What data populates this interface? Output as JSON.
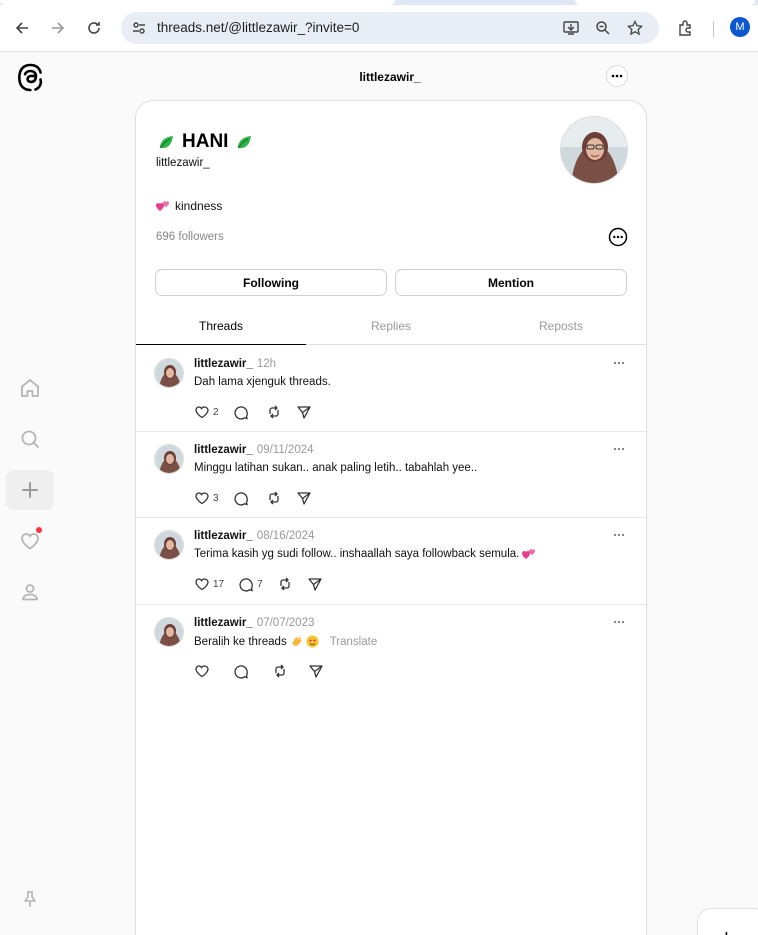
{
  "browser": {
    "url": "threads.net/@littlezawir_?invite=0",
    "profile_initial": "M"
  },
  "header": {
    "title": "littlezawir_"
  },
  "profile": {
    "display_name": "HANI",
    "username": "littlezawir_",
    "bio": "kindness",
    "followers": "696 followers",
    "following_label": "Following",
    "mention_label": "Mention"
  },
  "tabs": [
    {
      "label": "Threads",
      "active": true
    },
    {
      "label": "Replies",
      "active": false
    },
    {
      "label": "Reposts",
      "active": false
    }
  ],
  "posts": [
    {
      "username": "littlezawir_",
      "time": "12h",
      "text": "Dah lama xjenguk threads.",
      "likes": "2",
      "replies": "",
      "translate": ""
    },
    {
      "username": "littlezawir_",
      "time": "09/11/2024",
      "text": "Minggu latihan sukan.. anak paling letih.. tabahlah yee..",
      "likes": "3",
      "replies": "",
      "translate": ""
    },
    {
      "username": "littlezawir_",
      "time": "08/16/2024",
      "text": "Terima kasih yg sudi follow.. inshaallah saya followback semula.",
      "likes": "17",
      "replies": "7",
      "translate": ""
    },
    {
      "username": "littlezawir_",
      "time": "07/07/2023",
      "text": "Beralih ke threads",
      "likes": "",
      "replies": "",
      "translate": "Translate"
    }
  ],
  "colors": {
    "accent_blue": "#0b57d0",
    "notification_red": "#ff3040",
    "leaf_green": "#2fb34a",
    "heart_pink": "#e83e8c"
  },
  "icons": {
    "nav": [
      "home-icon",
      "search-icon",
      "create-icon",
      "activity-icon",
      "profile-icon",
      "pin-icon"
    ]
  }
}
